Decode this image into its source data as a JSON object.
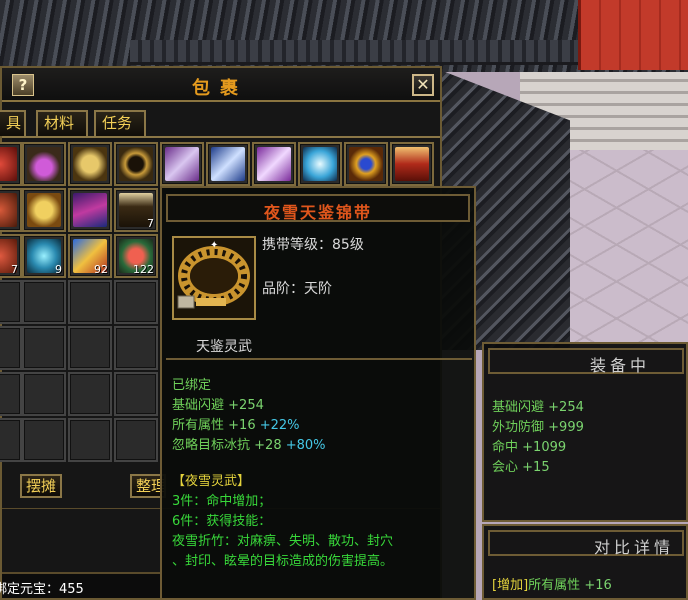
{
  "bag": {
    "title": "包裹",
    "help_label": "?",
    "close_label": "✕",
    "tabs": [
      "具",
      "材料",
      "任务"
    ],
    "buttons": {
      "stall": "摆摊",
      "sort": "整理"
    },
    "bound_ingot_label": "绑定元宝：",
    "bound_ingot_value": "455",
    "item_quantities": [
      "7",
      "7",
      "9",
      "92",
      "122"
    ]
  },
  "tooltip": {
    "item_name": "夜雪天鉴锦带",
    "carry_level": "携带等级：85级",
    "grade": "品阶：天阶",
    "sub_name": "天鉴灵武",
    "bound": "已绑定",
    "stats": [
      {
        "name": "基础闪避",
        "base": "+254",
        "bonus": ""
      },
      {
        "name": "所有属性",
        "base": "+16",
        "bonus": "+22%"
      },
      {
        "name": "忽略目标冰抗",
        "base": "+28",
        "bonus": "+80%"
      }
    ],
    "set_name": "【夜雪灵武】",
    "set_lines": [
      "3件：命中增加；",
      "6件：获得技能：",
      "夜雪折竹：对麻痹、失明、散功、封穴",
      "、封印、眩晕的目标造成的伤害提高。"
    ]
  },
  "equipped": {
    "title": "装备中",
    "stats": [
      {
        "name": "基础闪避",
        "value": "+254"
      },
      {
        "name": "外功防御",
        "value": "+999"
      },
      {
        "name": "命中",
        "value": "+1099"
      },
      {
        "name": "会心",
        "value": "+15"
      }
    ]
  },
  "compare": {
    "title": "对比详情",
    "line_tag": "[增加]",
    "line_name": "所有属性",
    "line_value": "+16"
  }
}
